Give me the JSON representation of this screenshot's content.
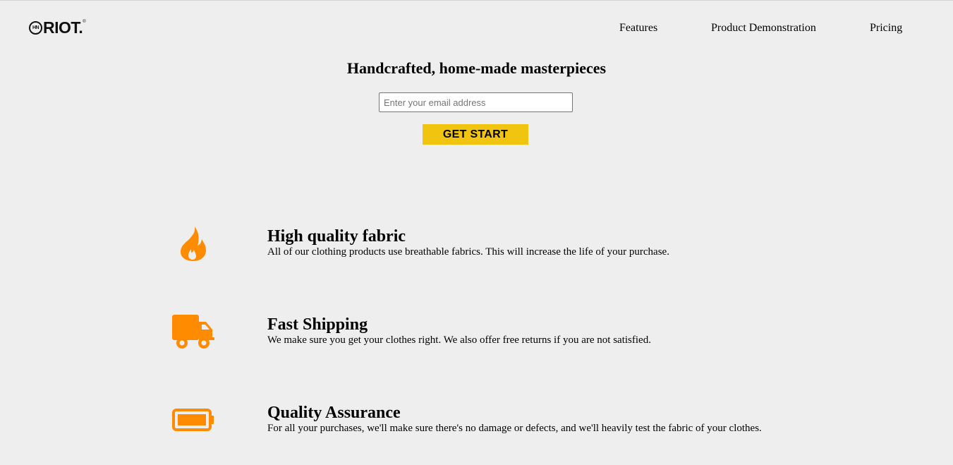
{
  "header": {
    "logo": {
      "badge_text": "HN",
      "brand_text": "RIOT.",
      "registered_mark": "®"
    },
    "nav": [
      {
        "label": "Features"
      },
      {
        "label": "Product Demonstration"
      },
      {
        "label": "Pricing"
      }
    ]
  },
  "hero": {
    "title": "Handcrafted, home-made masterpieces",
    "email_placeholder": "Enter your email address",
    "email_value": "",
    "button_label": "GET START"
  },
  "features": [
    {
      "icon": "fire-icon",
      "title": "High quality fabric",
      "description": "All of our clothing products use breathable fabrics. This will increase the life of your purchase."
    },
    {
      "icon": "truck-icon",
      "title": "Fast Shipping",
      "description": "We make sure you get your clothes right. We also offer free returns if you are not satisfied."
    },
    {
      "icon": "battery-full-icon",
      "title": "Quality Assurance",
      "description": "For all your purchases, we'll make sure there's no damage or defects, and we'll heavily test the fabric of your clothes."
    }
  ],
  "colors": {
    "background": "#eeeeee",
    "accent_button": "#f1c40f",
    "icon_orange": "#ff8c00"
  }
}
